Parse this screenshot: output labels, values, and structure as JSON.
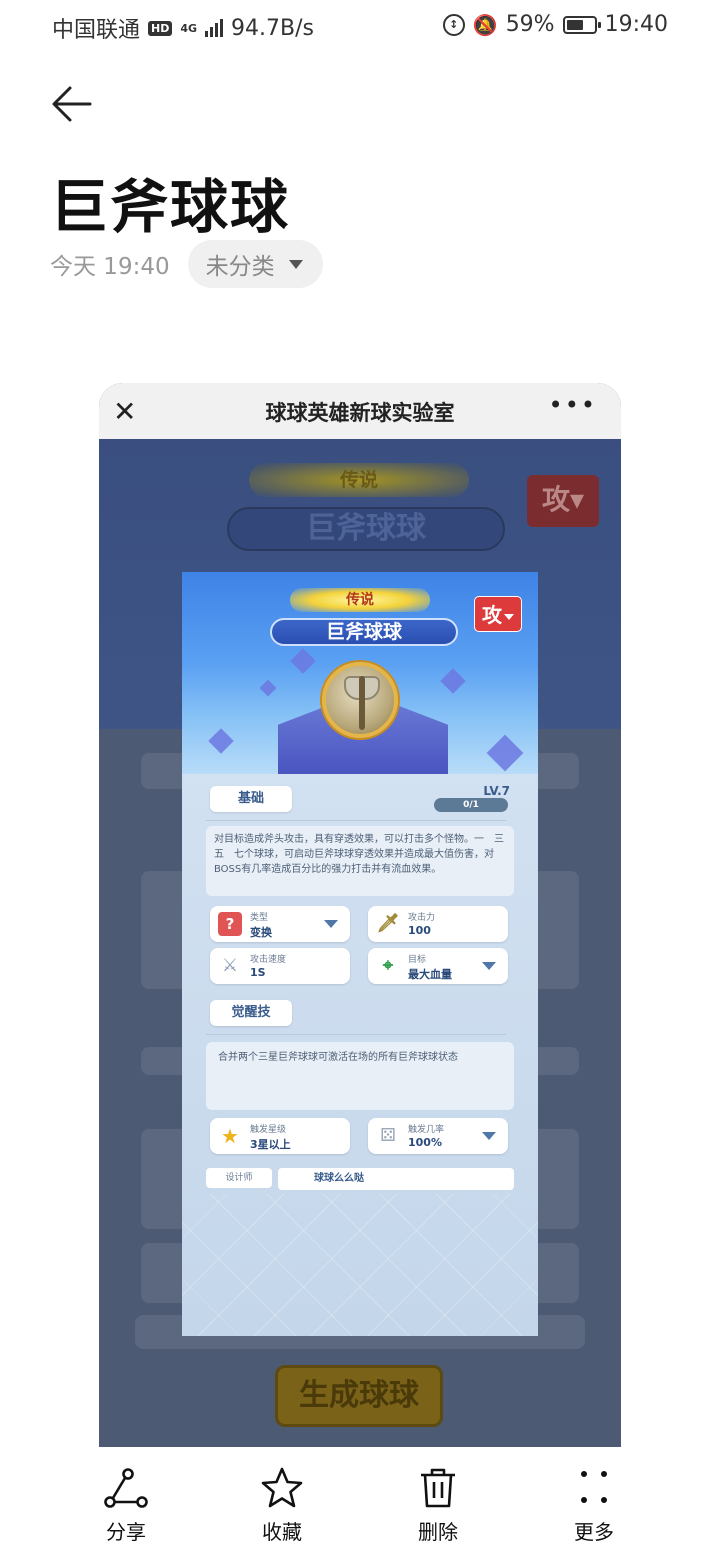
{
  "status_bar": {
    "carrier": "中国联通",
    "hd": "HD",
    "net_type": "4G",
    "speed": "94.7B/s",
    "battery": "59%",
    "time": "19:40"
  },
  "note": {
    "title": "巨斧球球",
    "date": "今天 19:40",
    "category": "未分类"
  },
  "mini_program": {
    "title": "球球英雄新球实验室",
    "bg_rarity": "传说",
    "bg_name": "巨斧球球",
    "bg_attack": "攻",
    "generate_button": "生成球球"
  },
  "popup": {
    "rarity": "传说",
    "name": "巨斧球球",
    "attack_type": "攻",
    "tab_basic": "基础",
    "level": "LV.7",
    "progress": "0/1",
    "description": "对目标造成斧头攻击，具有穿透效果，可以打击多个怪物。一　三　五　七个球球，可启动巨斧球球穿透效果并造成最大值伤害，对BOSS有几率造成百分比的强力打击并有流血效果。",
    "stats": [
      {
        "label": "类型",
        "value": "变换",
        "icon": "question-icon"
      },
      {
        "label": "攻击力",
        "value": "100",
        "icon": "sword-icon"
      },
      {
        "label": "攻击速度",
        "value": "1S",
        "icon": "crossed-swords-icon"
      },
      {
        "label": "目标",
        "value": "最大血量",
        "icon": "crosshair-icon"
      }
    ],
    "tab_awaken": "觉醒技",
    "awaken_desc": "合并两个三星巨斧球球可激活在场的所有巨斧球球状态",
    "trigger": [
      {
        "label": "触发星级",
        "value": "3星以上",
        "icon": "star-icon"
      },
      {
        "label": "触发几率",
        "value": "100%",
        "icon": "dice-icon"
      }
    ],
    "designer_label": "设计师",
    "designer_value": "球球么么哒"
  },
  "toolbar": {
    "share": "分享",
    "favorite": "收藏",
    "delete": "删除",
    "more": "更多"
  }
}
